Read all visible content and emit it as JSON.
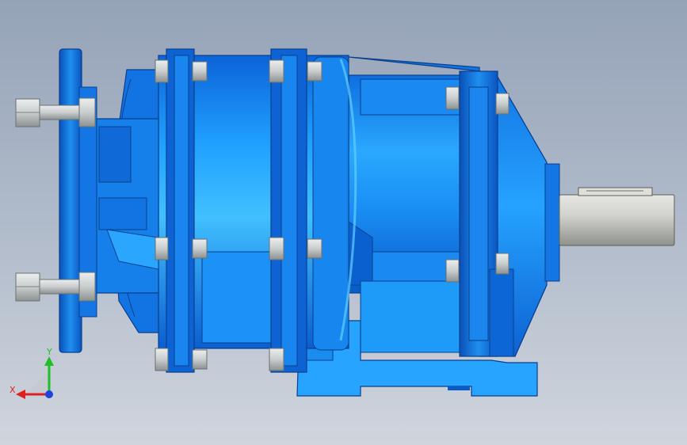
{
  "colors": {
    "body_main": "#1f8ff0",
    "body_light": "#3fb8ff",
    "body_dark": "#0a5bc8",
    "body_deep": "#0648a8",
    "outline": "#0a3f8c",
    "bolt": "#c8cccd",
    "bolt_dark": "#8e9394",
    "shaft": "#c9cbc6",
    "axis_x": "#e02020",
    "axis_y": "#1fbf2a",
    "axis_z": "#2040e0"
  },
  "triad": {
    "x_label": "X",
    "y_label": "Y"
  }
}
